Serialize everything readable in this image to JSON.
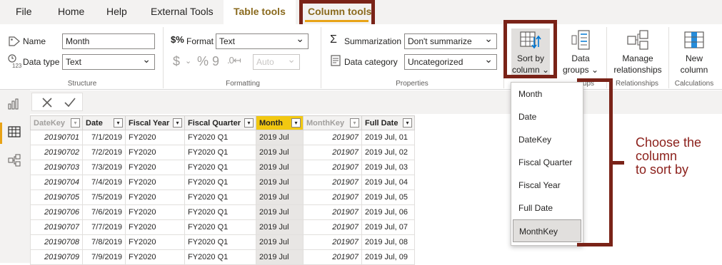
{
  "menu": {
    "tabs": [
      "File",
      "Home",
      "Help",
      "External Tools",
      "Table tools",
      "Column tools"
    ]
  },
  "structure": {
    "name_label": "Name",
    "name_value": "Month",
    "datatype_label": "Data type",
    "datatype_value": "Text",
    "group_label": "Structure"
  },
  "formatting": {
    "format_label": "Format",
    "format_value": "Text",
    "currency_symbol": "$",
    "percent_symbol": "%",
    "comma_symbol": "9",
    "decimals_value": "Auto",
    "group_label": "Formatting"
  },
  "properties": {
    "summarization_label": "Summarization",
    "summarization_value": "Don't summarize",
    "category_label": "Data category",
    "category_value": "Uncategorized",
    "group_label": "Properties"
  },
  "buttons": {
    "sort_by_line1": "Sort by",
    "sort_by_line2": "column",
    "data_groups_line1": "Data",
    "data_groups_line2": "groups",
    "manage_rel_line1": "Manage",
    "manage_rel_line2": "relationships",
    "new_column_line1": "New",
    "new_column_line2": "column"
  },
  "group_labels": {
    "groups": "ups",
    "relationships": "Relationships",
    "calculations": "Calculations"
  },
  "table": {
    "headers": [
      "DateKey",
      "Date",
      "Fiscal Year",
      "Fiscal Quarter",
      "Month",
      "MonthKey",
      "Full Date"
    ],
    "rows": [
      [
        "20190701",
        "7/1/2019",
        "FY2020",
        "FY2020 Q1",
        "2019 Jul",
        "201907",
        "2019 Jul, 01"
      ],
      [
        "20190702",
        "7/2/2019",
        "FY2020",
        "FY2020 Q1",
        "2019 Jul",
        "201907",
        "2019 Jul, 02"
      ],
      [
        "20190703",
        "7/3/2019",
        "FY2020",
        "FY2020 Q1",
        "2019 Jul",
        "201907",
        "2019 Jul, 03"
      ],
      [
        "20190704",
        "7/4/2019",
        "FY2020",
        "FY2020 Q1",
        "2019 Jul",
        "201907",
        "2019 Jul, 04"
      ],
      [
        "20190705",
        "7/5/2019",
        "FY2020",
        "FY2020 Q1",
        "2019 Jul",
        "201907",
        "2019 Jul, 05"
      ],
      [
        "20190706",
        "7/6/2019",
        "FY2020",
        "FY2020 Q1",
        "2019 Jul",
        "201907",
        "2019 Jul, 06"
      ],
      [
        "20190707",
        "7/7/2019",
        "FY2020",
        "FY2020 Q1",
        "2019 Jul",
        "201907",
        "2019 Jul, 07"
      ],
      [
        "20190708",
        "7/8/2019",
        "FY2020",
        "FY2020 Q1",
        "2019 Jul",
        "201907",
        "2019 Jul, 08"
      ],
      [
        "20190709",
        "7/9/2019",
        "FY2020",
        "FY2020 Q1",
        "2019 Jul",
        "201907",
        "2019 Jul, 09"
      ]
    ]
  },
  "sort_dropdown": {
    "items": [
      "Month",
      "Date",
      "DateKey",
      "Fiscal Quarter",
      "Fiscal Year",
      "Full Date",
      "MonthKey"
    ],
    "selected": "MonthKey"
  },
  "annotation": {
    "line1": "Choose the",
    "line2": "column",
    "line3": "to sort by"
  },
  "colors": {
    "highlight_frame": "#7a2318",
    "accent_yellow": "#f2c811",
    "annotation_text": "#8b1f1a"
  }
}
